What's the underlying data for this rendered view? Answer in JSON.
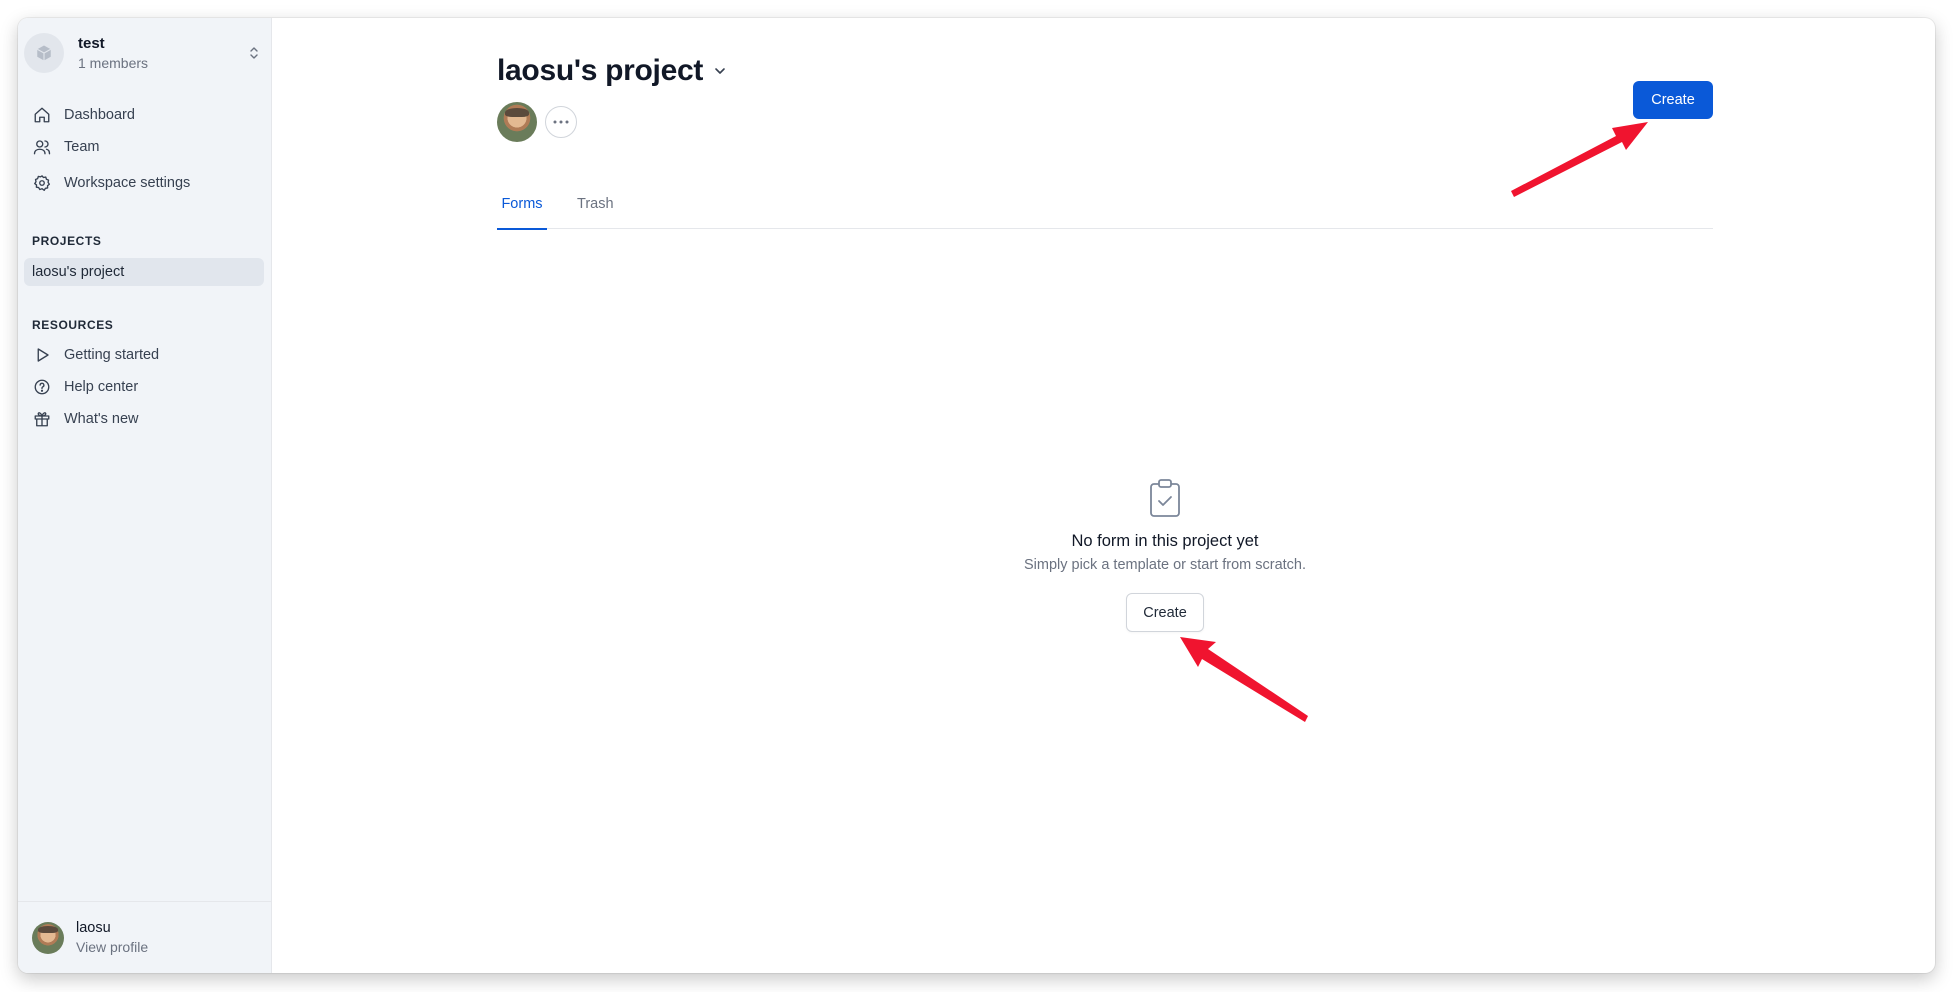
{
  "workspace": {
    "name": "test",
    "members": "1 members"
  },
  "sidebar": {
    "nav": [
      {
        "label": "Dashboard",
        "icon": "home-icon"
      },
      {
        "label": "Team",
        "icon": "users-icon"
      },
      {
        "label": "Workspace settings",
        "icon": "gear-icon"
      }
    ],
    "projects_label": "PROJECTS",
    "projects": [
      {
        "label": "laosu's project"
      }
    ],
    "resources_label": "RESOURCES",
    "resources": [
      {
        "label": "Getting started",
        "icon": "play-icon"
      },
      {
        "label": "Help center",
        "icon": "help-circle-icon"
      },
      {
        "label": "What's new",
        "icon": "gift-icon"
      }
    ]
  },
  "user": {
    "name": "laosu",
    "link": "View profile"
  },
  "main": {
    "title": "laosu's project",
    "create_label": "Create",
    "tabs": [
      {
        "label": "Forms"
      },
      {
        "label": "Trash"
      }
    ],
    "empty": {
      "title": "No form in this project yet",
      "subtitle": "Simply pick a template or start from scratch.",
      "button": "Create"
    }
  },
  "colors": {
    "accent": "#0a59d8",
    "sidebar_bg": "#f1f4f8",
    "arrow": "#f0142f"
  }
}
